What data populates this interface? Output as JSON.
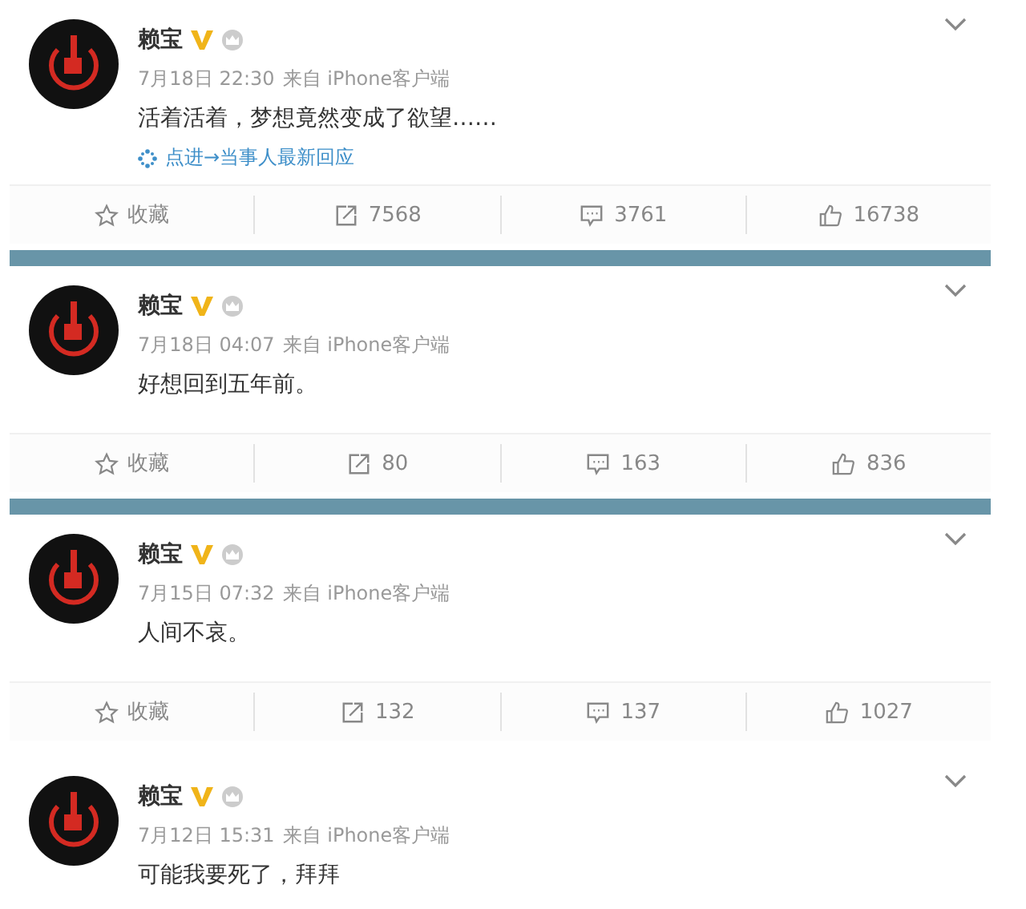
{
  "posts": [
    {
      "name": "赖宝",
      "time": "7月18日 22:30",
      "source": "来自 iPhone客户端",
      "text": "活着活着，梦想竟然变成了欲望……",
      "link": "点进→当事人最新回应",
      "actions": {
        "favorite": "收藏",
        "reposts": "7568",
        "comments": "3761",
        "likes": "16738"
      },
      "divider": true
    },
    {
      "name": "赖宝",
      "time": "7月18日 04:07",
      "source": "来自 iPhone客户端",
      "text": "好想回到五年前。",
      "actions": {
        "favorite": "收藏",
        "reposts": "80",
        "comments": "163",
        "likes": "836"
      },
      "divider": true
    },
    {
      "name": "赖宝",
      "time": "7月15日 07:32",
      "source": "来自 iPhone客户端",
      "text": "人间不哀。",
      "actions": {
        "favorite": "收藏",
        "reposts": "132",
        "comments": "137",
        "likes": "1027"
      },
      "divider": false
    },
    {
      "name": "赖宝",
      "time": "7月12日 15:31",
      "source": "来自 iPhone客户端",
      "text": "可能我要死了，拜拜",
      "divider": false
    }
  ]
}
